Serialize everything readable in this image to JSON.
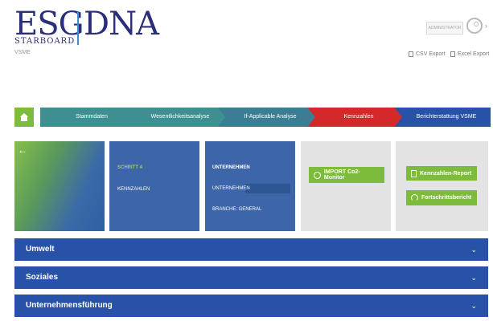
{
  "header": {
    "logo_left": "ESG",
    "logo_right": "DNA",
    "logo_tagline": "STARBOARD",
    "subtitle": "VSME",
    "user_label": "ADMINISTRATOR",
    "csv_export": "CSV Export",
    "excel_export": "Excel Export"
  },
  "steps": [
    {
      "label": "Stammdaten",
      "color": "#3d8f91"
    },
    {
      "label": "Wesentlichkeitsanalyse",
      "color": "#3d8f91"
    },
    {
      "label": "If-Applicable Analyse",
      "color": "#3d7d93"
    },
    {
      "label": "Kennzahlen",
      "color": "#d4282a"
    },
    {
      "label": "Berichterstattung VSME",
      "color": "#2852a7"
    }
  ],
  "step_card": {
    "title": "SCHRITT 4",
    "subtitle": "KENNZAHLEN"
  },
  "company_card": {
    "title": "UNTERNEHMEN",
    "item1": "UNTERNEHMEN",
    "item2": "BRANCHE: GENERAL"
  },
  "actions": {
    "import_label": "IMPORT Co2-Monitor",
    "report_label": "Kennzahlen-Report",
    "progress_label": "Fortschrittsbericht"
  },
  "accordions": [
    {
      "label": "Umwelt"
    },
    {
      "label": "Soziales"
    },
    {
      "label": "Unternehmensführung"
    }
  ],
  "colors": {
    "brand_green": "#7dbb3c",
    "brand_blue": "#2852a7",
    "active_step": "#d4282a"
  }
}
